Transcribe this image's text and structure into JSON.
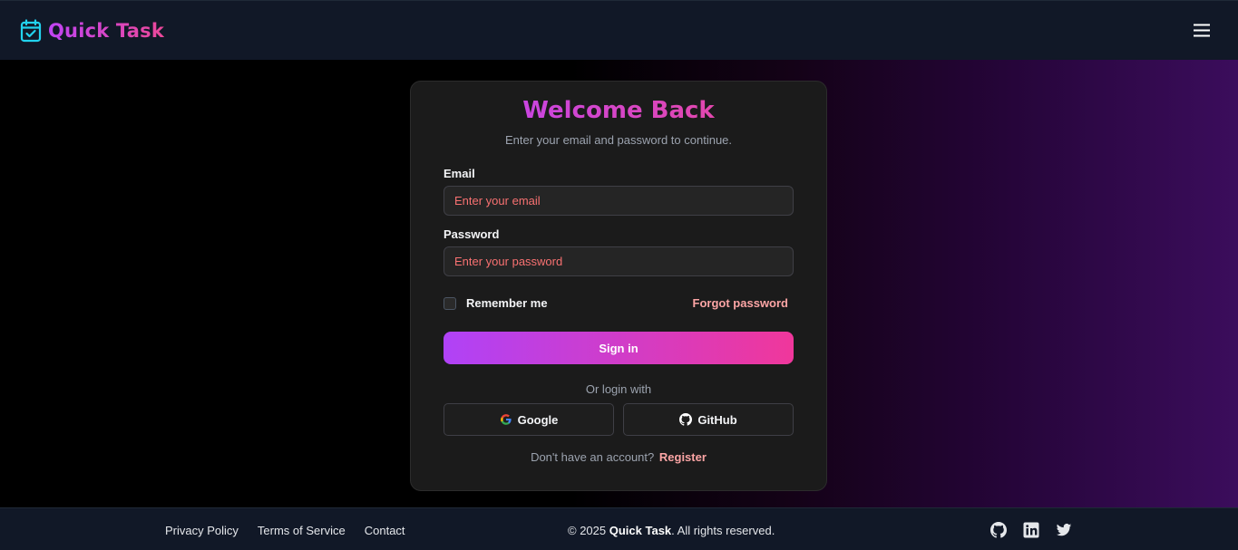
{
  "header": {
    "brand_name": "Quick Task",
    "brand_icon": "calendar-check-icon",
    "menu_icon": "hamburger-menu-icon"
  },
  "colors": {
    "accent_purple": "#c044f5",
    "accent_pink": "#ec4899",
    "header_bg": "#111827",
    "card_bg": "#1b1b1b",
    "placeholder_red": "#f87171",
    "link_pink": "#fca5a5"
  },
  "login": {
    "title": "Welcome Back",
    "subtitle": "Enter your email and password to continue.",
    "email_label": "Email",
    "email_placeholder": "Enter your email",
    "email_value": "",
    "password_label": "Password",
    "password_placeholder": "Enter your password",
    "password_value": "",
    "remember_label": "Remember me",
    "remember_checked": false,
    "forgot_label": "Forgot password",
    "signin_label": "Sign in",
    "or_text": "Or login with",
    "google_label": "Google",
    "github_label": "GitHub",
    "no_account_text": "Don't have an account?",
    "register_label": "Register"
  },
  "footer": {
    "links": [
      "Privacy Policy",
      "Terms of Service",
      "Contact"
    ],
    "copyright_prefix": "© 2025",
    "copyright_brand": "Quick Task",
    "copyright_suffix": ". All rights reserved.",
    "social_icons": [
      "github-icon",
      "linkedin-icon",
      "twitter-icon"
    ]
  }
}
